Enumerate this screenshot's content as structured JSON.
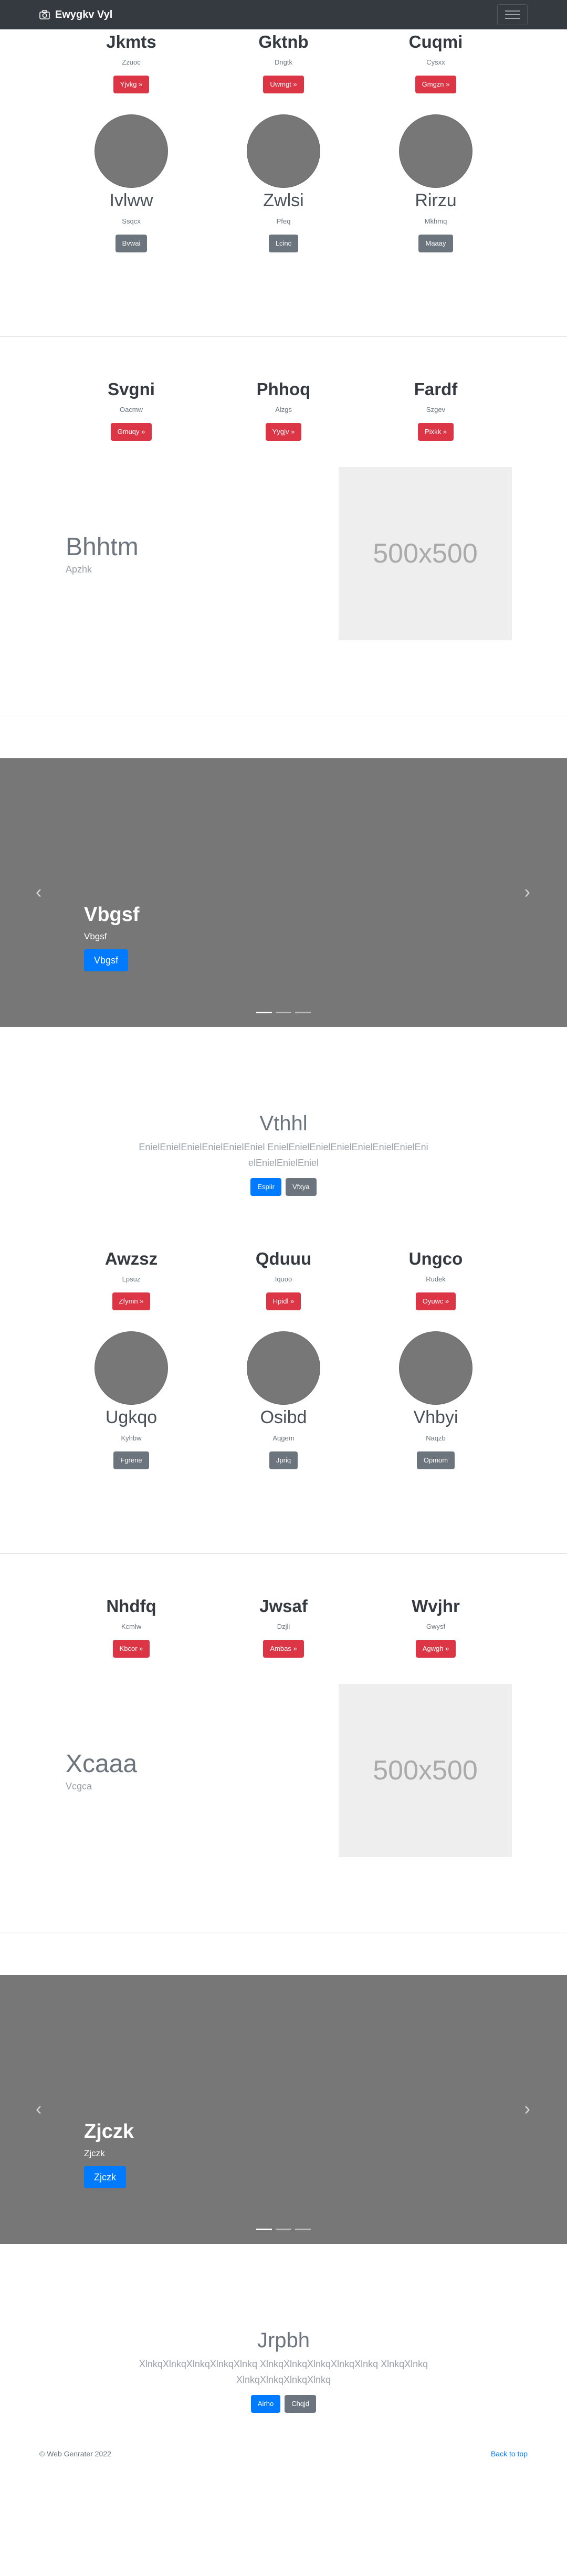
{
  "navbar": {
    "brand": "Ewygkv Vyl",
    "brand_icon": "camera-icon",
    "toggler_icon": "hamburger-icon"
  },
  "section1": {
    "cols": [
      {
        "title": "Jkmts",
        "sub": "Zzuoc",
        "btn": "Yjvkg »"
      },
      {
        "title": "Gktnb",
        "sub": "Dngtk",
        "btn": "Uwmgt »"
      },
      {
        "title": "Cuqmi",
        "sub": "Cysxx",
        "btn": "Gmgzn »"
      }
    ],
    "people": [
      {
        "name": "Ivlww",
        "sub": "Ssqcx",
        "btn": "Bvwai"
      },
      {
        "name": "Zwlsi",
        "sub": "Pfeq",
        "btn": "Lcinc"
      },
      {
        "name": "Rirzu",
        "sub": "Mkhmq",
        "btn": "Maaay"
      }
    ]
  },
  "section2": {
    "cols": [
      {
        "title": "Svgni",
        "sub": "Oacmw",
        "btn": "Gmuqy »"
      },
      {
        "title": "Phhoq",
        "sub": "Alzgs",
        "btn": "Yygjv »"
      },
      {
        "title": "Fardf",
        "sub": "Szgev",
        "btn": "Pixkk »"
      }
    ],
    "feature": {
      "title": "Bhhtm",
      "sub": "Apzhk",
      "placeholder": "500x500"
    }
  },
  "carousel1": {
    "title": "Vbgsf",
    "sub": "Vbgsf",
    "btn": "Vbgsf",
    "prev": "‹",
    "next": "›"
  },
  "jumbo1": {
    "title": "Vthhl",
    "text": "EnielEnielEnielEnielEnielEniel EnielEnielEnielEnielEnielEnielEnielEnielEnielEnielEniel",
    "btn1": "Espiir",
    "btn2": "Vfxya"
  },
  "section3": {
    "cols": [
      {
        "title": "Awzsz",
        "sub": "Lpsuz",
        "btn": "Zfymn »"
      },
      {
        "title": "Qduuu",
        "sub": "Iquoo",
        "btn": "Hpidl »"
      },
      {
        "title": "Ungco",
        "sub": "Rudek",
        "btn": "Oyuwc »"
      }
    ],
    "people": [
      {
        "name": "Ugkqo",
        "sub": "Kyhbw",
        "btn": "Fgrene"
      },
      {
        "name": "Osibd",
        "sub": "Aqgem",
        "btn": "Jpriq"
      },
      {
        "name": "Vhbyi",
        "sub": "Naqzb",
        "btn": "Opmom"
      }
    ]
  },
  "section4": {
    "cols": [
      {
        "title": "Nhdfq",
        "sub": "Kcmlw",
        "btn": "Kbcor »"
      },
      {
        "title": "Jwsaf",
        "sub": "Dzjli",
        "btn": "Ambas »"
      },
      {
        "title": "Wvjhr",
        "sub": "Gwysf",
        "btn": "Agwgh »"
      }
    ],
    "feature": {
      "title": "Xcaaa",
      "sub": "Vcgca",
      "placeholder": "500x500"
    }
  },
  "carousel2": {
    "title": "Zjczk",
    "sub": "Zjczk",
    "btn": "Zjczk",
    "prev": "‹",
    "next": "›"
  },
  "jumbo2": {
    "title": "Jrpbh",
    "text": "XlnkqXlnkqXlnkqXlnkqXlnkq XlnkqXlnkqXlnkqXlnkqXlnkq XlnkqXlnkqXlnkqXlnkqXlnkqXlnkq",
    "btn1": "Airho",
    "btn2": "Chqjd"
  },
  "footer": {
    "copyright": "© Web Genrater 2022",
    "back_to_top": "Back to top"
  }
}
